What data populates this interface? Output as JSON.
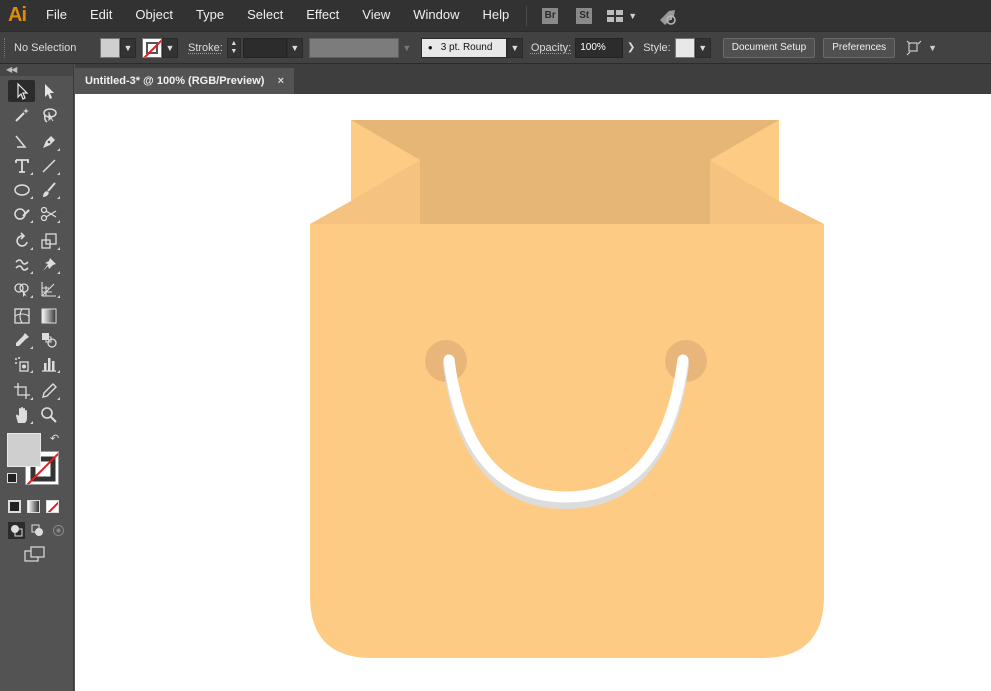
{
  "app": {
    "logo": "Ai",
    "menu": [
      "File",
      "Edit",
      "Object",
      "Type",
      "Select",
      "Effect",
      "View",
      "Window",
      "Help"
    ],
    "bridge_badge": "Br",
    "stock_badge": "St"
  },
  "controlbar": {
    "selection_label": "No Selection",
    "stroke_label": "Stroke:",
    "brush_value": "3 pt. Round",
    "opacity_label": "Opacity:",
    "opacity_value": "100%",
    "style_label": "Style:",
    "document_setup": "Document Setup",
    "preferences": "Preferences"
  },
  "document": {
    "tab_title": "Untitled-3* @ 100% (RGB/Preview)",
    "close_glyph": "×"
  },
  "colors": {
    "bag_front": "#fecb84",
    "bag_side": "#f6c27f",
    "bag_inner": "#e6b677",
    "handle_hole": "#e8b67a",
    "handle": "#ffffff",
    "handle_shadow": "#dcdcdc"
  }
}
